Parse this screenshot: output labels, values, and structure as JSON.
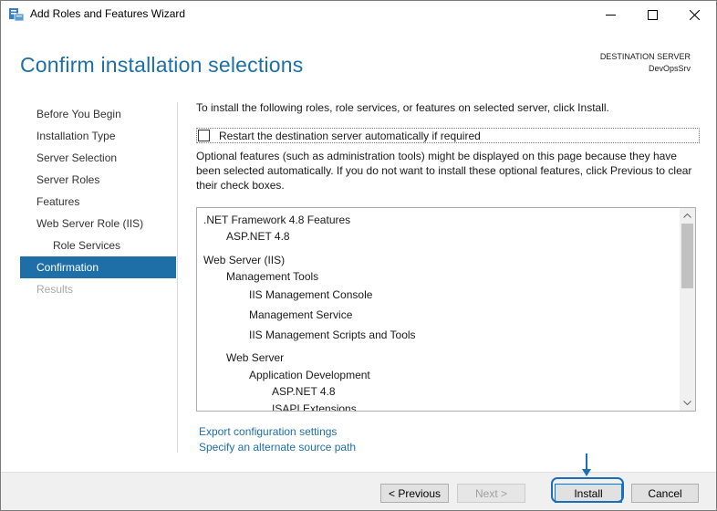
{
  "window": {
    "title": "Add Roles and Features Wizard",
    "minimize_icon": "minimize-icon",
    "maximize_icon": "maximize-icon",
    "close_icon": "close-icon"
  },
  "header": {
    "title": "Confirm installation selections",
    "destination_label": "DESTINATION SERVER",
    "destination_server": "DevOpsSrv"
  },
  "nav": {
    "items": [
      {
        "label": "Before You Begin",
        "state": "normal"
      },
      {
        "label": "Installation Type",
        "state": "normal"
      },
      {
        "label": "Server Selection",
        "state": "normal"
      },
      {
        "label": "Server Roles",
        "state": "normal"
      },
      {
        "label": "Features",
        "state": "normal"
      },
      {
        "label": "Web Server Role (IIS)",
        "state": "normal"
      },
      {
        "label": "Role Services",
        "state": "sub"
      },
      {
        "label": "Confirmation",
        "state": "active"
      },
      {
        "label": "Results",
        "state": "disabled"
      }
    ]
  },
  "content": {
    "intro": "To install the following roles, role services, or features on selected server, click Install.",
    "restart_label": "Restart the destination server automatically if required",
    "restart_checked": false,
    "optional_text": "Optional features (such as administration tools) might be displayed on this page because they have been selected automatically. If you do not want to install these optional features, click Previous to clear their check boxes.",
    "features": [
      {
        "label": ".NET Framework 4.8 Features",
        "level": 0
      },
      {
        "label": "ASP.NET 4.8",
        "level": 1
      },
      {
        "label": "Web Server (IIS)",
        "level": 0
      },
      {
        "label": "Management Tools",
        "level": 1
      },
      {
        "label": "IIS Management Console",
        "level": 2
      },
      {
        "label": "Management Service",
        "level": 2
      },
      {
        "label": "IIS Management Scripts and Tools",
        "level": 2
      },
      {
        "label": "Web Server",
        "level": 1
      },
      {
        "label": "Application Development",
        "level": 2
      },
      {
        "label": "ASP.NET 4.8",
        "level": 3
      },
      {
        "label": "ISAPI Extensions",
        "level": 3
      }
    ],
    "export_link": "Export configuration settings",
    "alternate_link": "Specify an alternate source path"
  },
  "footer": {
    "previous_label": "< Previous",
    "next_label": "Next >",
    "install_label": "Install",
    "cancel_label": "Cancel"
  },
  "colors": {
    "accent": "#1e6fa8",
    "highlight": "#1b6fb9"
  }
}
